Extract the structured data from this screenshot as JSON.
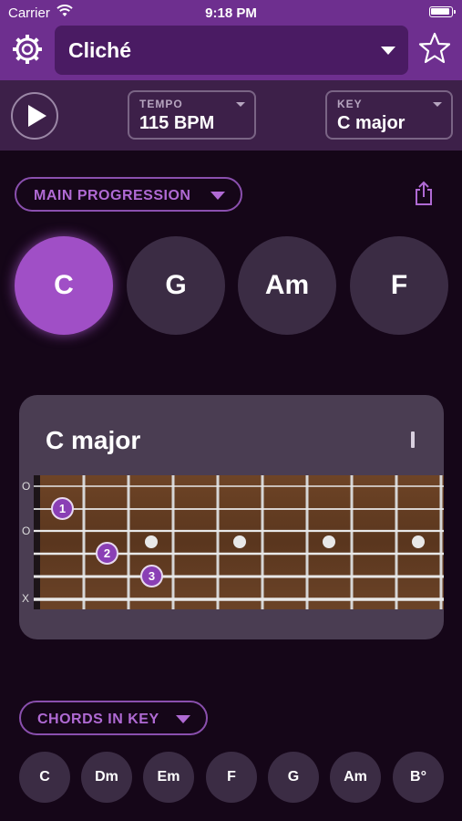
{
  "status": {
    "carrier": "Carrier",
    "time": "9:18 PM"
  },
  "header": {
    "title": "Cliché"
  },
  "toolbar": {
    "tempo_label": "TEMPO",
    "tempo_value": "115 BPM",
    "key_label": "KEY",
    "key_value": "C major"
  },
  "progression": {
    "label": "MAIN PROGRESSION",
    "chords": [
      "C",
      "G",
      "Am",
      "F"
    ],
    "selected": "C"
  },
  "chord_card": {
    "title": "C major",
    "string_markers": [
      "O",
      "O",
      "X"
    ],
    "fingers": [
      "1",
      "2",
      "3"
    ]
  },
  "chords_in_key": {
    "label": "CHORDS IN KEY",
    "chords": [
      "C",
      "Dm",
      "Em",
      "F",
      "G",
      "Am",
      "B°"
    ]
  },
  "colors": {
    "accent": "#a04fc6",
    "header": "#6e2f8f",
    "background": "#150618"
  }
}
